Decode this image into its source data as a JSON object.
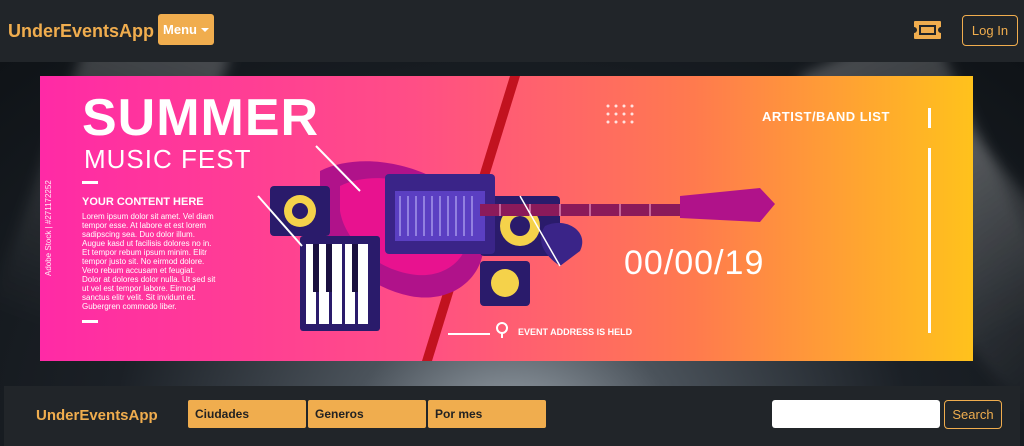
{
  "navbar": {
    "brand": "UnderEventsApp",
    "menu_label": "Menu",
    "login_label": "Log In"
  },
  "banner": {
    "title": "SUMMER",
    "subtitle": "MUSIC FEST",
    "content_heading": "YOUR CONTENT HERE",
    "lorem": "Lorem ipsum dolor sit amet. Vel diam tempor esse. At labore et est lorem sadipscing sea. Duo dolor illum. Augue kasd ut facilisis dolores no in. Et tempor rebum ipsum minim. Elitr tempor justo sit. No eirmod dolore. Vero rebum accusam et feugiat. Dolor at dolores dolor nulla. Ut sed sit ut vel est tempor labore. Eirmod sanctus elitr velit. Sit invidunt et. Gubergren commodo liber.",
    "artist_list": "ARTIST/BAND LIST",
    "date": "00/00/19",
    "address": "EVENT ADDRESS IS HELD",
    "stock_id": "Adobe Stock | #271172252"
  },
  "footer": {
    "brand": "UnderEventsApp",
    "dropdowns": [
      "Ciudades",
      "Generos",
      "Por mes"
    ],
    "search_placeholder": "",
    "search_label": "Search"
  },
  "colors": {
    "accent": "#f0ad4e",
    "navbar_bg": "#212529"
  },
  "icons": {
    "ticket": "ticket-icon"
  }
}
